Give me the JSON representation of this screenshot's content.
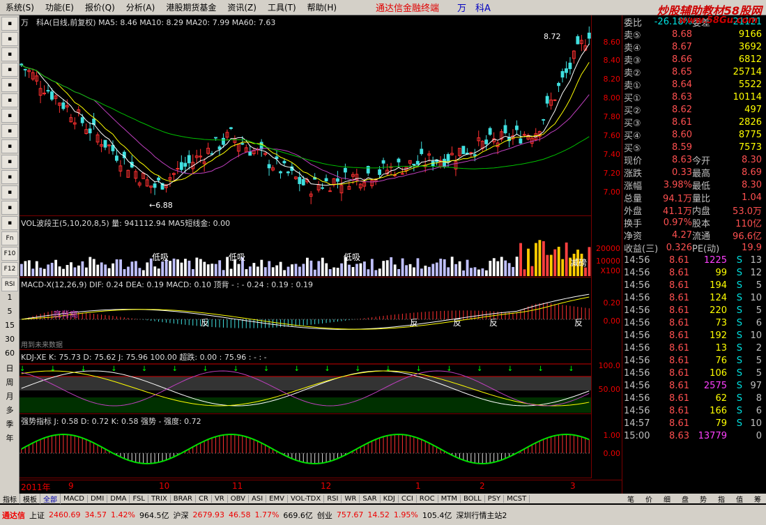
{
  "menu": [
    "系统(S)",
    "功能(E)",
    "报价(Q)",
    "分析(A)",
    "港股期货基金",
    "资讯(Z)",
    "工具(T)",
    "帮助(H)"
  ],
  "brand": "通达信金融终端",
  "stock_title": "万　科A",
  "watermark": "炒股辅助教材58股网",
  "watermark_url": "www.58Gu.com",
  "toolbar_periods": [
    "1",
    "5",
    "15",
    "30",
    "60",
    "日",
    "周",
    "月",
    "多",
    "季",
    "年"
  ],
  "toolbar_icons": [
    "Fn",
    "F10",
    "F12",
    "RSI"
  ],
  "kline": {
    "title": "万　科A(日线,前复权) MA5: 8.46 MA10: 8.29 MA20: 7.99 MA60: 7.63",
    "ylabels": [
      "8.60",
      "8.40",
      "8.20",
      "8.00",
      "7.80",
      "7.60",
      "7.40",
      "7.20",
      "7.00"
    ],
    "high_label": "8.72",
    "low_label": "←6.88"
  },
  "vol": {
    "title": "VOL波段王(5,10,20,8,5) 量: 941112.94   MA5短线金: 0.00",
    "ylabels": [
      "20000",
      "10000",
      "X100"
    ],
    "marks": [
      "低吸",
      "低吸",
      "低吸",
      "减磅"
    ]
  },
  "macd": {
    "title": "MACD-X(12,26,9) DIF: 0.24 DEA: 0.19 MACD: 0.10   顶背 - : - 0.24 : 0.19 : 0.19",
    "ylabels": [
      "0.20",
      "0.00"
    ],
    "marks": [
      "底背离",
      "反",
      "反",
      "反",
      "反",
      "反"
    ]
  },
  "kdj": {
    "title": "KDJ-XE  K: 75.73 D: 75.62 J: 75.96  100.00 超跌: 0.00 : 75.96 : - : -",
    "pre": "用到未来数据",
    "ylabels": [
      "100.0",
      "50.00"
    ]
  },
  "strong": {
    "title": "强势指标 J: 0.58 D: 0.72 K: 0.58 强势 - 强度: 0.72",
    "ylabels": [
      "1.00",
      "0.00"
    ]
  },
  "dates": [
    "2011年",
    "9",
    "10",
    "11",
    "12",
    "1",
    "2",
    "3"
  ],
  "tabs": [
    "指标",
    "模板",
    "全部",
    "MACD",
    "DMI",
    "DMA",
    "FSL",
    "TRIX",
    "BRAR",
    "CR",
    "VR",
    "OBV",
    "ASI",
    "EMV",
    "VOL-TDX",
    "RSI",
    "WR",
    "SAR",
    "KDJ",
    "CCI",
    "ROC",
    "MTM",
    "BOLL",
    "PSY",
    "MCST"
  ],
  "side": {
    "top": [
      "委比",
      "-26.18%",
      "委差",
      "-21121"
    ],
    "sell": [
      [
        "卖⑤",
        "8.68",
        "9166"
      ],
      [
        "卖④",
        "8.67",
        "3692"
      ],
      [
        "卖③",
        "8.66",
        "6812"
      ],
      [
        "卖②",
        "8.65",
        "25714"
      ],
      [
        "卖①",
        "8.64",
        "5522"
      ]
    ],
    "buy": [
      [
        "买①",
        "8.63",
        "10114"
      ],
      [
        "买②",
        "8.62",
        "497"
      ],
      [
        "买③",
        "8.61",
        "2826"
      ],
      [
        "买④",
        "8.60",
        "8775"
      ],
      [
        "买⑤",
        "8.59",
        "7573"
      ]
    ],
    "quote": [
      [
        "现价",
        "8.63",
        "今开",
        "8.30"
      ],
      [
        "涨跌",
        "0.33",
        "最高",
        "8.69"
      ],
      [
        "涨幅",
        "3.98%",
        "最低",
        "8.30"
      ],
      [
        "总量",
        "94.1万",
        "量比",
        "1.04"
      ],
      [
        "外盘",
        "41.1万",
        "内盘",
        "53.0万"
      ],
      [
        "换手",
        "0.97%",
        "股本",
        "110亿"
      ],
      [
        "净资",
        "4.27",
        "流通",
        "96.6亿"
      ],
      [
        "收益(三)",
        "0.326",
        "PE(动)",
        "19.9"
      ]
    ],
    "ticks": [
      [
        "14:56",
        "8.61",
        "1225",
        "S",
        "13"
      ],
      [
        "14:56",
        "8.61",
        "99",
        "S",
        "12"
      ],
      [
        "14:56",
        "8.61",
        "194",
        "S",
        "5"
      ],
      [
        "14:56",
        "8.61",
        "124",
        "S",
        "10"
      ],
      [
        "14:56",
        "8.61",
        "220",
        "S",
        "5"
      ],
      [
        "14:56",
        "8.61",
        "73",
        "S",
        "6"
      ],
      [
        "14:56",
        "8.61",
        "192",
        "S",
        "10"
      ],
      [
        "14:56",
        "8.61",
        "13",
        "S",
        "2"
      ],
      [
        "14:56",
        "8.61",
        "76",
        "S",
        "5"
      ],
      [
        "14:56",
        "8.61",
        "106",
        "S",
        "5"
      ],
      [
        "14:56",
        "8.61",
        "2575",
        "S",
        "97"
      ],
      [
        "14:56",
        "8.61",
        "62",
        "S",
        "8"
      ],
      [
        "14:56",
        "8.61",
        "166",
        "S",
        "6"
      ],
      [
        "14:57",
        "8.61",
        "79",
        "S",
        "10"
      ],
      [
        "15:00",
        "8.63",
        "13779",
        "",
        "0"
      ]
    ],
    "tabs": [
      "笔",
      "价",
      "细",
      "盘",
      "势",
      "指",
      "值",
      "筹"
    ]
  },
  "status": {
    "items": [
      "通达信",
      "上证",
      "2460.69",
      "34.57",
      "1.42%",
      "964.5亿",
      "沪深",
      "2679.93",
      "46.58",
      "1.77%",
      "669.6亿",
      "创业",
      "757.67",
      "14.52",
      "1.95%",
      "105.4亿",
      "深圳行情主站2"
    ]
  }
}
